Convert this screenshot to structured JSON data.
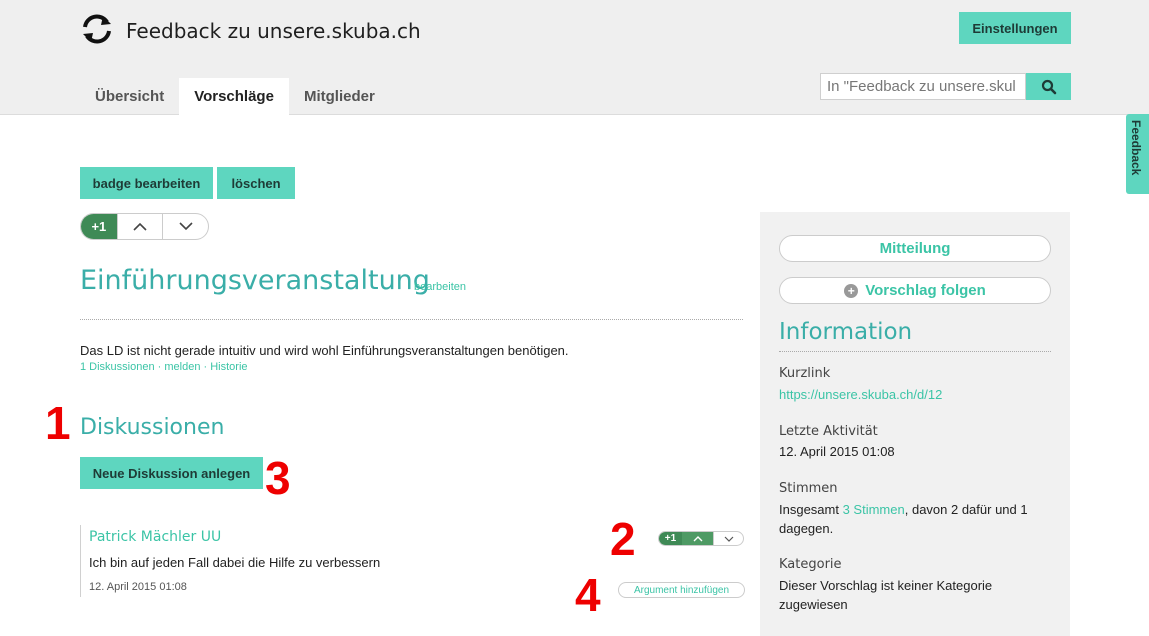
{
  "header": {
    "title": "Feedback zu unsere.skuba.ch",
    "settings_label": "Einstellungen",
    "tabs": [
      {
        "label": "Übersicht"
      },
      {
        "label": "Vorschläge"
      },
      {
        "label": "Mitglieder"
      }
    ],
    "search_placeholder": "In \"Feedback zu unsere.skuba.ch\" suchen",
    "search_value": "In \"Feedback zu unsere.skul"
  },
  "feedback_tab_label": "Feedback",
  "toolbar": {
    "badge_label": "badge bearbeiten",
    "delete_label": "löschen"
  },
  "proposal": {
    "votes": "+1",
    "title": "Einführungsveranstaltung",
    "edit_label": "bearbeiten",
    "description": "Das LD ist nicht gerade intuitiv und wird wohl Einführungsveranstaltungen benötigen.",
    "meta_links": "1 Diskussionen · melden · Historie"
  },
  "discussions": {
    "heading": "Diskussionen",
    "new_label": "Neue Diskussion anlegen",
    "items": [
      {
        "author": "Patrick Mächler UU",
        "text": "Ich bin auf jeden Fall dabei die Hilfe zu verbessern",
        "date": "12. April 2015 01:08",
        "votes": "+1",
        "add_argument_label": "Argument hinzufügen"
      }
    ]
  },
  "markers": [
    "1",
    "2",
    "3",
    "4"
  ],
  "sidebar": {
    "message_label": "Mitteilung",
    "follow_label": "Vorschlag folgen",
    "info_heading": "Information",
    "shortlink_label": "Kurzlink",
    "shortlink_value": "https://unsere.skuba.ch/d/12",
    "last_activity_label": "Letzte Aktivität",
    "last_activity_value": "12. April 2015 01:08",
    "votes_label": "Stimmen",
    "votes_prefix": "Insgesamt ",
    "votes_link": "3 Stimmen",
    "votes_line1_suffix": ", davon 2 dafür und 1",
    "votes_line2": "dagegen.",
    "category_label": "Kategorie",
    "category_line1": "Dieser Vorschlag ist keiner Kategorie",
    "category_line2": "zugewiesen"
  },
  "colors": {
    "accent": "#5ed6bf",
    "heading": "#3aaea8",
    "link": "#3bc4a6",
    "vote_green": "#3f8a56",
    "marker_red": "#ee0000"
  }
}
